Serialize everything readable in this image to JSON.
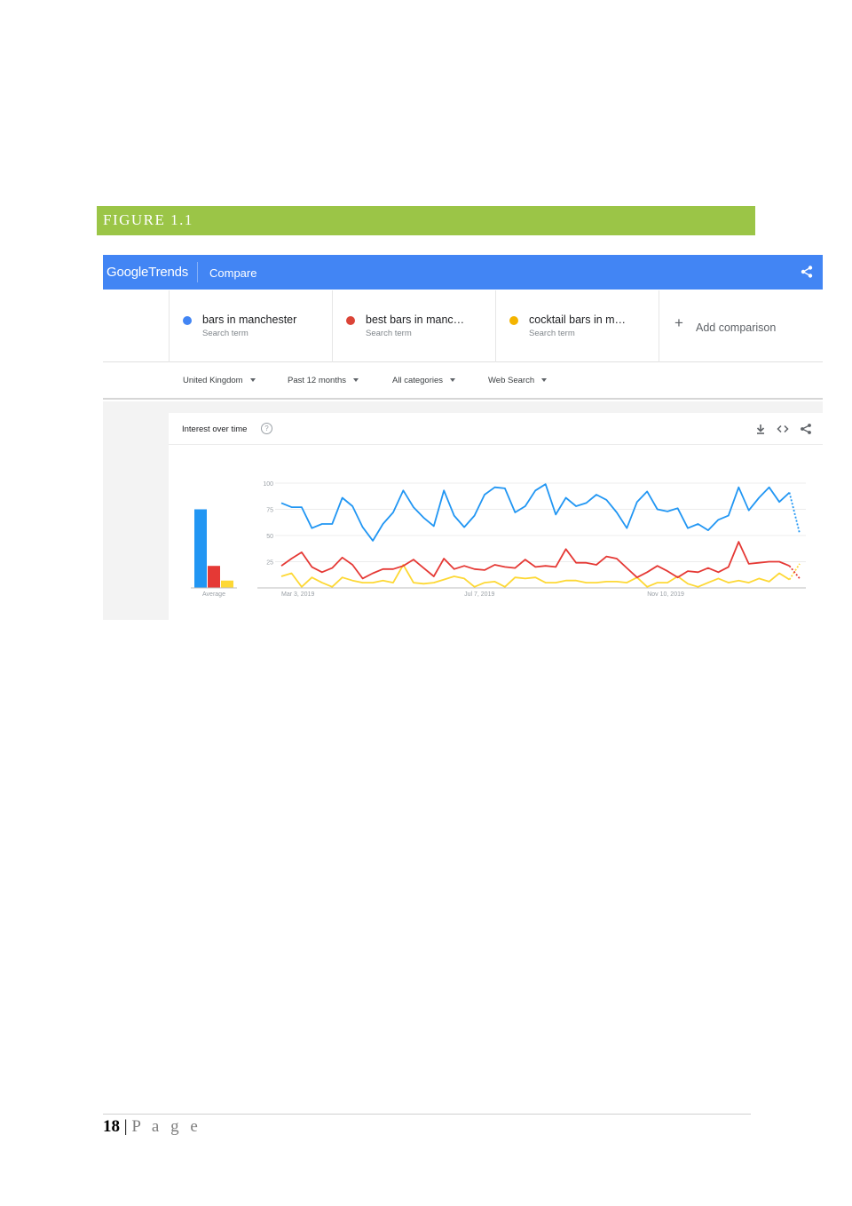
{
  "figure_label": "FIGURE 1.1",
  "header": {
    "logo_google": "Google",
    "logo_trends": "Trends",
    "compare_label": "Compare",
    "share_icon": "share-icon"
  },
  "terms": [
    {
      "name": "bars in manchester",
      "sub": "Search term",
      "color": "#4285f4"
    },
    {
      "name": "best bars in manc…",
      "sub": "Search term",
      "color": "#db4437"
    },
    {
      "name": "cocktail bars in m…",
      "sub": "Search term",
      "color": "#f4b400"
    }
  ],
  "add_comparison": "Add comparison",
  "filters": {
    "region": "United Kingdom",
    "period": "Past 12 months",
    "category": "All categories",
    "property": "Web Search"
  },
  "card": {
    "title": "Interest over time",
    "help_icon": "help-icon",
    "download_icon": "download-icon",
    "embed_icon": "embed-icon",
    "share_icon": "share-icon"
  },
  "chart_data": {
    "type": "line",
    "ylim": [
      0,
      100
    ],
    "y_ticks": [
      "100",
      "75",
      "50",
      "25"
    ],
    "x_tick_labels": [
      "Mar 3, 2019",
      "Jul 7, 2019",
      "Nov 10, 2019"
    ],
    "x_tick_index": [
      0,
      18,
      36
    ],
    "average_label": "Average",
    "averages": [
      75,
      21,
      7
    ],
    "series": [
      {
        "name": "bars in manchester",
        "color": "#2196f3",
        "values": [
          81,
          77,
          77,
          57,
          61,
          61,
          86,
          78,
          58,
          45,
          61,
          72,
          93,
          77,
          67,
          59,
          93,
          69,
          58,
          69,
          89,
          96,
          95,
          72,
          78,
          93,
          99,
          70,
          86,
          78,
          81,
          89,
          84,
          72,
          57,
          82,
          92,
          75,
          73,
          76,
          57,
          61,
          55,
          65,
          69,
          96,
          74,
          86,
          96,
          82,
          91,
          52
        ]
      },
      {
        "name": "best bars in manc…",
        "color": "#e53935",
        "values": [
          21,
          28,
          34,
          20,
          15,
          19,
          29,
          22,
          9,
          14,
          18,
          18,
          21,
          27,
          19,
          11,
          28,
          18,
          21,
          18,
          17,
          22,
          20,
          19,
          27,
          20,
          21,
          20,
          37,
          24,
          24,
          22,
          30,
          28,
          19,
          10,
          15,
          21,
          16,
          10,
          16,
          15,
          19,
          15,
          20,
          44,
          23,
          24,
          25,
          25,
          21,
          9
        ]
      },
      {
        "name": "cocktail bars in m…",
        "color": "#fdd835",
        "values": [
          11,
          14,
          1,
          10,
          5,
          1,
          10,
          7,
          5,
          5,
          7,
          5,
          22,
          5,
          4,
          5,
          8,
          11,
          9,
          1,
          5,
          6,
          1,
          10,
          9,
          10,
          5,
          5,
          7,
          7,
          5,
          5,
          6,
          6,
          5,
          10,
          1,
          5,
          5,
          11,
          4,
          1,
          5,
          9,
          5,
          7,
          5,
          9,
          6,
          14,
          8,
          23
        ]
      }
    ]
  },
  "footer": {
    "page_number": "18",
    "separator": "|",
    "page_word": "P a g e"
  }
}
